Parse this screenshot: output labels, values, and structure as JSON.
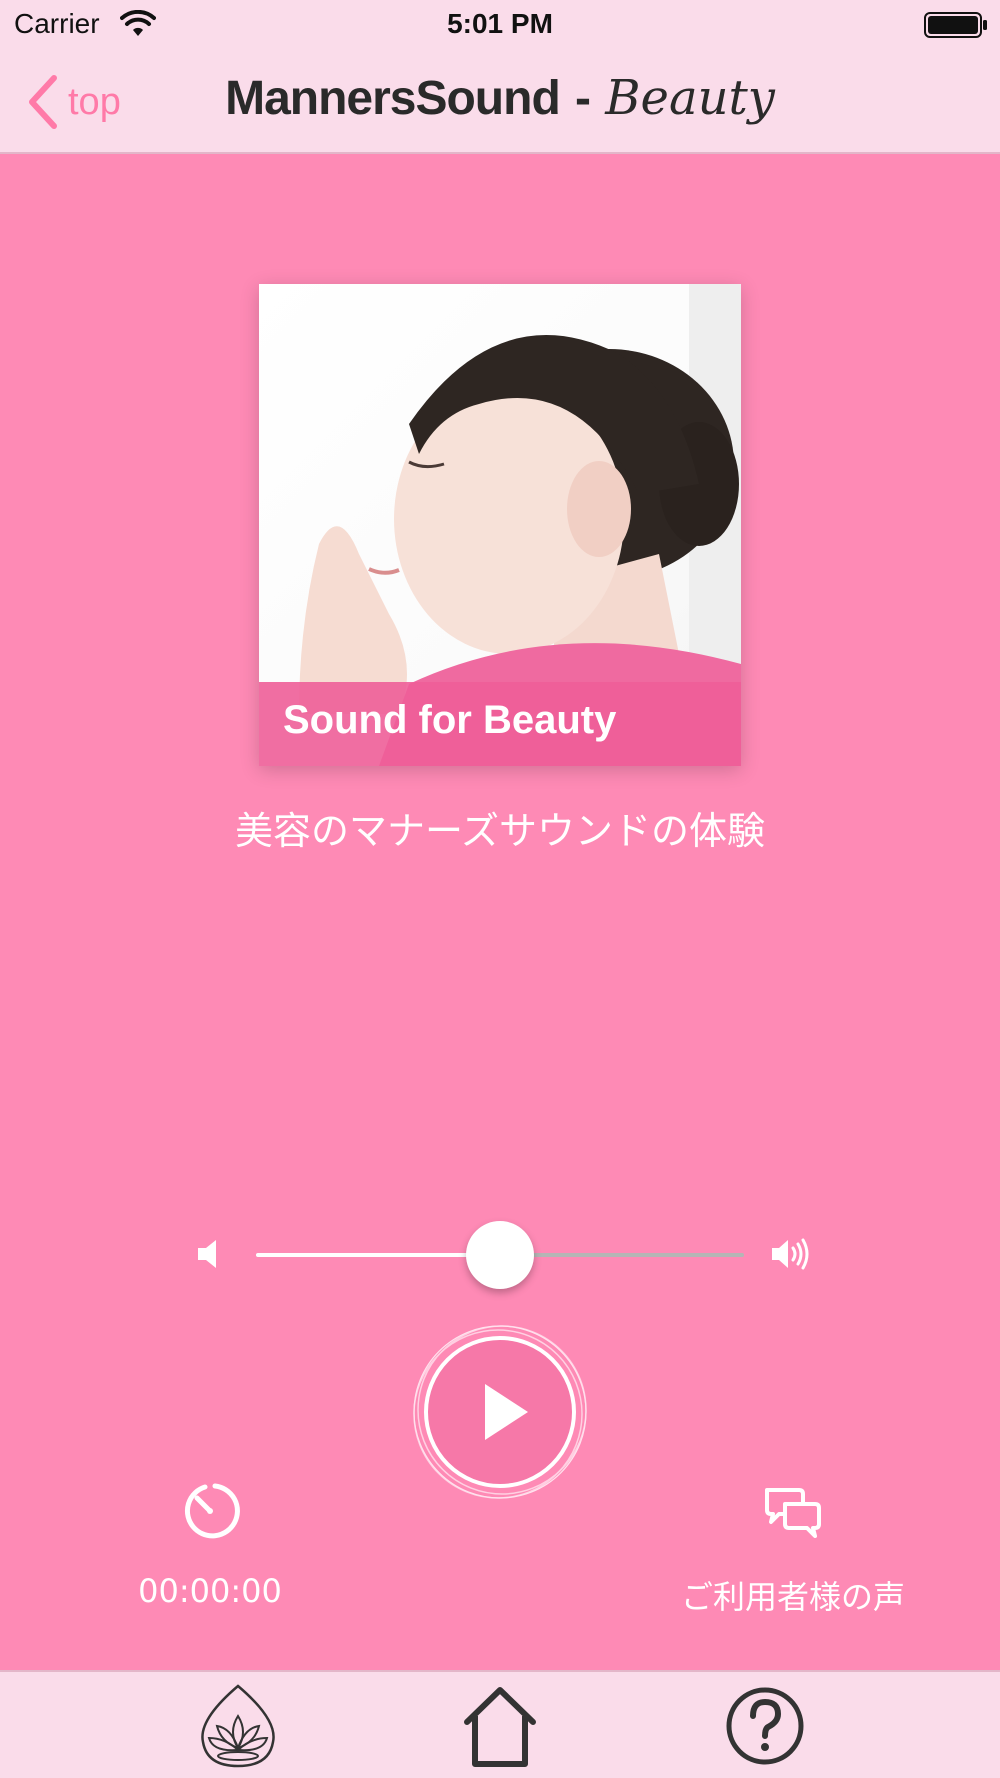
{
  "status_bar": {
    "carrier": "Carrier",
    "time": "5:01 PM",
    "wifi_icon": "wifi-icon",
    "battery_icon": "battery-icon"
  },
  "nav": {
    "back_label": "top",
    "back_icon": "chevron-left-icon",
    "title_main": "MannersSound",
    "title_separator": "-",
    "title_sub": "Beauty",
    "accent_color": "#ff7aa8"
  },
  "artwork": {
    "banner_text": "Sound for Beauty",
    "banner_color": "#ee5e98"
  },
  "track": {
    "title": "美容のマナーズサウンドの体験"
  },
  "volume": {
    "level_percent": 50,
    "low_icon": "volume-low-icon",
    "high_icon": "volume-high-icon"
  },
  "player": {
    "play_icon": "play-icon",
    "button_color": "#f678a8"
  },
  "timer": {
    "icon": "timer-icon",
    "value": "00:00:00"
  },
  "voices": {
    "icon": "chat-bubbles-icon",
    "label": "ご利用者様の声"
  },
  "tab_bar": {
    "tabs": [
      {
        "icon": "lotus-icon"
      },
      {
        "icon": "home-icon"
      },
      {
        "icon": "help-icon"
      }
    ],
    "background": "#fadcea"
  },
  "theme": {
    "background": "#fe8ab5"
  }
}
